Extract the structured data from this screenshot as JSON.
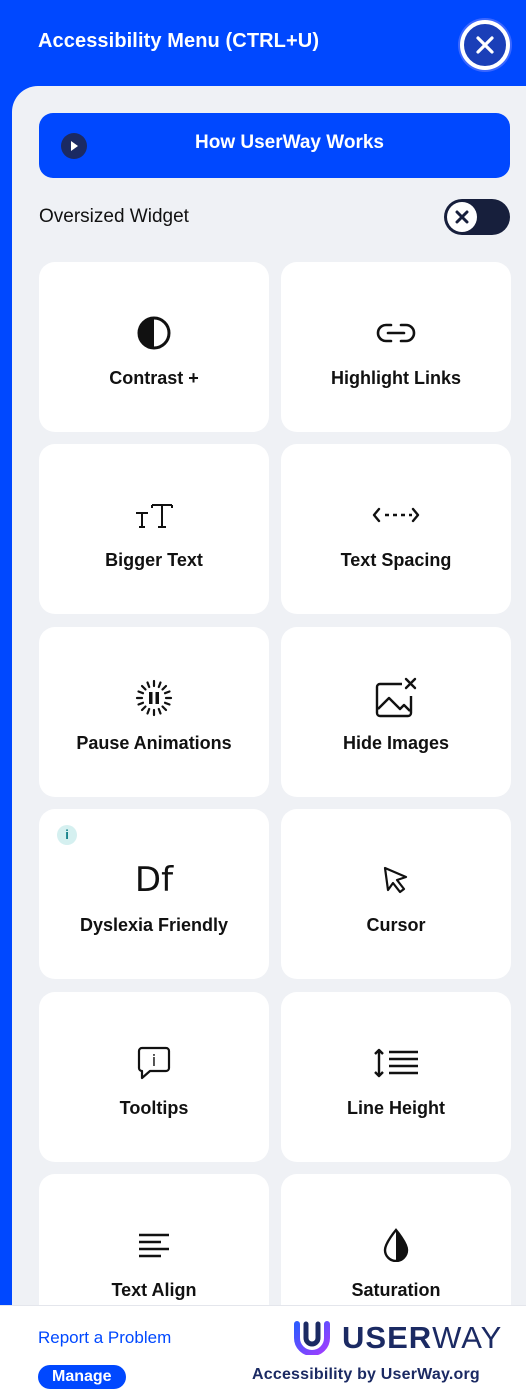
{
  "header": {
    "title": "Accessibility Menu (CTRL+U)"
  },
  "how_button": {
    "label": "How UserWay Works"
  },
  "oversized": {
    "label": "Oversized Widget"
  },
  "cards": [
    {
      "label": "Contrast +",
      "icon": "contrast-icon"
    },
    {
      "label": "Highlight Links",
      "icon": "link-icon"
    },
    {
      "label": "Bigger Text",
      "icon": "text-size-icon"
    },
    {
      "label": "Text Spacing",
      "icon": "text-spacing-icon"
    },
    {
      "label": "Pause Animations",
      "icon": "pause-animations-icon"
    },
    {
      "label": "Hide Images",
      "icon": "hide-images-icon"
    },
    {
      "label": "Dyslexia Friendly",
      "icon": "dyslexia-icon",
      "info": "i",
      "glyph": "Df"
    },
    {
      "label": "Cursor",
      "icon": "cursor-icon"
    },
    {
      "label": "Tooltips",
      "icon": "tooltip-icon",
      "glyph": "i"
    },
    {
      "label": "Line Height",
      "icon": "line-height-icon"
    },
    {
      "label": "Text Align",
      "icon": "text-align-icon"
    },
    {
      "label": "Saturation",
      "icon": "saturation-icon"
    }
  ],
  "footer": {
    "report": "Report a Problem",
    "manage": "Manage",
    "logo_bold": "USER",
    "logo_light": "WAY",
    "byline": "Accessibility by UserWay.org"
  },
  "colors": {
    "brand": "#0048ff",
    "panel": "#eff1f5",
    "dark": "#1b2a63"
  }
}
